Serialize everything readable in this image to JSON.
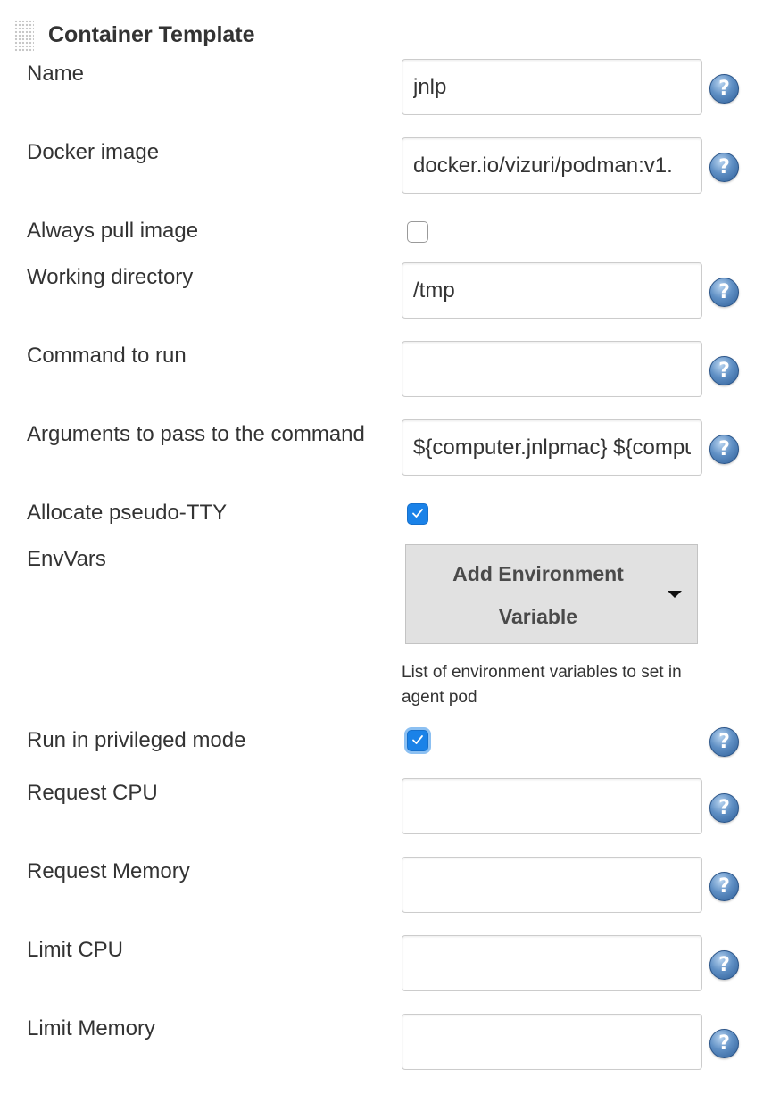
{
  "section": {
    "title": "Container Template"
  },
  "fields": {
    "name": {
      "label": "Name",
      "value": "jnlp"
    },
    "docker_image": {
      "label": "Docker image",
      "value": "docker.io/vizuri/podman:v1."
    },
    "always_pull_image": {
      "label": "Always pull image",
      "checked": false
    },
    "working_directory": {
      "label": "Working directory",
      "value": "/tmp"
    },
    "command_to_run": {
      "label": "Command to run",
      "value": ""
    },
    "arguments": {
      "label": "Arguments to pass to the command",
      "value": "${computer.jnlpmac} ${computer.name}"
    },
    "allocate_tty": {
      "label": "Allocate pseudo-TTY",
      "checked": true
    },
    "env_vars": {
      "label": "EnvVars",
      "button_label": "Add Environment Variable",
      "description": "List of environment variables to set in agent pod"
    },
    "privileged": {
      "label": "Run in privileged mode",
      "checked": true
    },
    "request_cpu": {
      "label": "Request CPU",
      "value": ""
    },
    "request_memory": {
      "label": "Request Memory",
      "value": ""
    },
    "limit_cpu": {
      "label": "Limit CPU",
      "value": ""
    },
    "limit_memory": {
      "label": "Limit Memory",
      "value": ""
    }
  },
  "help_icon_glyph": "?",
  "icons": {
    "help": "help-icon",
    "checkmark": "checkmark-icon",
    "dropdown": "caret-down-icon",
    "drag_handle": "drag-handle-icon"
  },
  "colors": {
    "checkbox_checked": "#1a82e8",
    "help_icon": "#5f8fc4",
    "button_bg": "#e1e1e1"
  }
}
